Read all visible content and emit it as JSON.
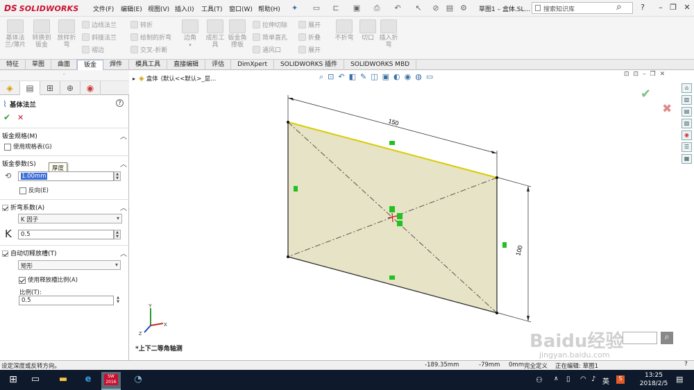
{
  "app": {
    "logo_ds": "DS",
    "logo_text": "SOLIDWORKS",
    "doc_title": "草图1 – 盒体.SL...",
    "search_placeholder": "搜索知识库"
  },
  "menu": [
    "文件(F)",
    "编辑(E)",
    "视图(V)",
    "插入(I)",
    "工具(T)",
    "窗口(W)",
    "帮助(H)"
  ],
  "toolbar_big": [
    {
      "label": "基体法兰/薄片",
      "lines": [
        "基体法",
        "兰/薄片"
      ]
    },
    {
      "label": "转换到钣金",
      "lines": [
        "转换到",
        "钣金"
      ]
    },
    {
      "label": "放样折弯",
      "lines": [
        "放样折",
        "弯"
      ]
    },
    {
      "label": "边角",
      "lines": [
        "边角",
        ""
      ]
    },
    {
      "label": "成形工具",
      "lines": [
        "成形工",
        "具"
      ]
    },
    {
      "label": "钣金角撑板",
      "lines": [
        "钣金角",
        "撑板"
      ]
    },
    {
      "label": "不折弯",
      "lines": [
        "不折弯",
        ""
      ]
    },
    {
      "label": "切口",
      "lines": [
        "切口",
        ""
      ]
    },
    {
      "label": "插入折弯",
      "lines": [
        "插入折",
        "弯"
      ]
    }
  ],
  "toolbar_small": {
    "col1": [
      "边线法兰",
      "斜接法兰",
      "褶边"
    ],
    "col2": [
      "转折",
      "绘制的折弯",
      "交叉-折断"
    ],
    "col3": [
      "拉伸切除",
      "简单直孔",
      "通风口"
    ],
    "col4": [
      "展开",
      "折叠",
      "展开"
    ]
  },
  "tabs": [
    "特征",
    "草图",
    "曲面",
    "钣金",
    "焊件",
    "模具工具",
    "直接编辑",
    "评估",
    "DimXpert",
    "SOLIDWORKS 插件",
    "SOLIDWORKS MBD"
  ],
  "active_tab": "钣金",
  "tree": {
    "part_name": "盒体",
    "config": "(默认<<默认>_显..."
  },
  "feature": {
    "title": "基体法兰",
    "help": "?"
  },
  "sections": {
    "sheet_metal_gauge": {
      "title": "钣金规格(M)",
      "use_gauge_table": "使用规格表(G)",
      "checked": false
    },
    "sheet_metal_params": {
      "title": "钣金参数(S)",
      "tooltip": "厚度",
      "thickness": "1.00mm",
      "reverse": "反向(E)",
      "reverse_checked": false
    },
    "bend_allowance": {
      "title": "折弯系数(A)",
      "type": "K 因子",
      "k_symbol": "K",
      "k_value": "0.5"
    },
    "auto_relief": {
      "title": "自动切释放槽(T)",
      "type": "矩形",
      "use_ratio": "使用释放槽比例(A)",
      "ratio_label": "比例(T):",
      "ratio_value": "0.5"
    }
  },
  "sketch": {
    "dim_width": "150",
    "dim_height": "100",
    "view_label": "*上下二等角轴测"
  },
  "triad": {
    "x": "X",
    "y": "Y",
    "z": "Z"
  },
  "status": {
    "message": "设定深度或反转方向。",
    "x": "-189.35mm",
    "y": "-79mm",
    "z": "0mm",
    "state": "完全定义",
    "editing": "正在编辑: 草图1"
  },
  "taskbar": {
    "time": "13:25",
    "date": "2018/2/5",
    "lang": "英",
    "sw_badge": "2016"
  },
  "watermark": {
    "text": "Baidu经验",
    "sub": "jingyan.baidu.com"
  },
  "colors": {
    "sheet_fill": "#e6e3c6",
    "sheet_edge": "#d8cc00",
    "accent_red": "#c8102e",
    "ok_green": "#2f9e2f"
  }
}
